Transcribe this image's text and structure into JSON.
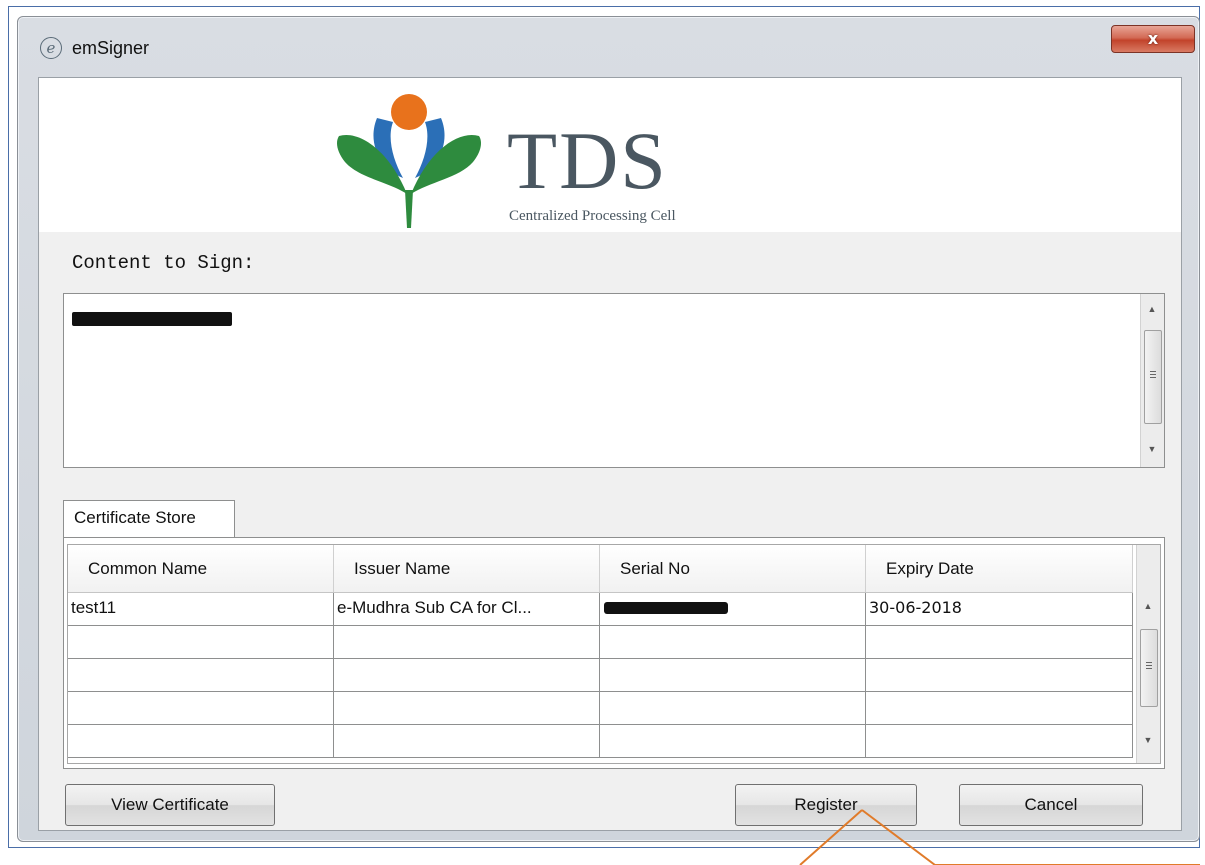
{
  "window": {
    "title": "emSigner",
    "app_icon_glyph": "e",
    "close_glyph": "x"
  },
  "banner": {
    "logo_title": "TDS",
    "logo_subtitle": "Centralized Processing Cell",
    "colors": {
      "orange": "#e8721c",
      "blue": "#2b6fb7",
      "green": "#2e8b3e",
      "text": "#4a5761"
    }
  },
  "content": {
    "label": "Content to Sign:",
    "value_redacted": true
  },
  "certificate_store": {
    "tab_label": "Certificate Store",
    "columns": [
      "Common Name",
      "Issuer Name",
      "Serial No",
      "Expiry Date"
    ],
    "rows": [
      {
        "common_name": "test11",
        "issuer_name": "e-Mudhra Sub CA for Cl...",
        "serial_no_redacted": true,
        "expiry_date": "30-06-2018"
      },
      {
        "common_name": "",
        "issuer_name": "",
        "serial_no_redacted": false,
        "expiry_date": ""
      },
      {
        "common_name": "",
        "issuer_name": "",
        "serial_no_redacted": false,
        "expiry_date": ""
      },
      {
        "common_name": "",
        "issuer_name": "",
        "serial_no_redacted": false,
        "expiry_date": ""
      },
      {
        "common_name": "",
        "issuer_name": "",
        "serial_no_redacted": false,
        "expiry_date": ""
      }
    ]
  },
  "buttons": {
    "view_certificate": "View Certificate",
    "register": "Register",
    "cancel": "Cancel"
  },
  "annotation": {
    "color": "#e07b2a"
  }
}
